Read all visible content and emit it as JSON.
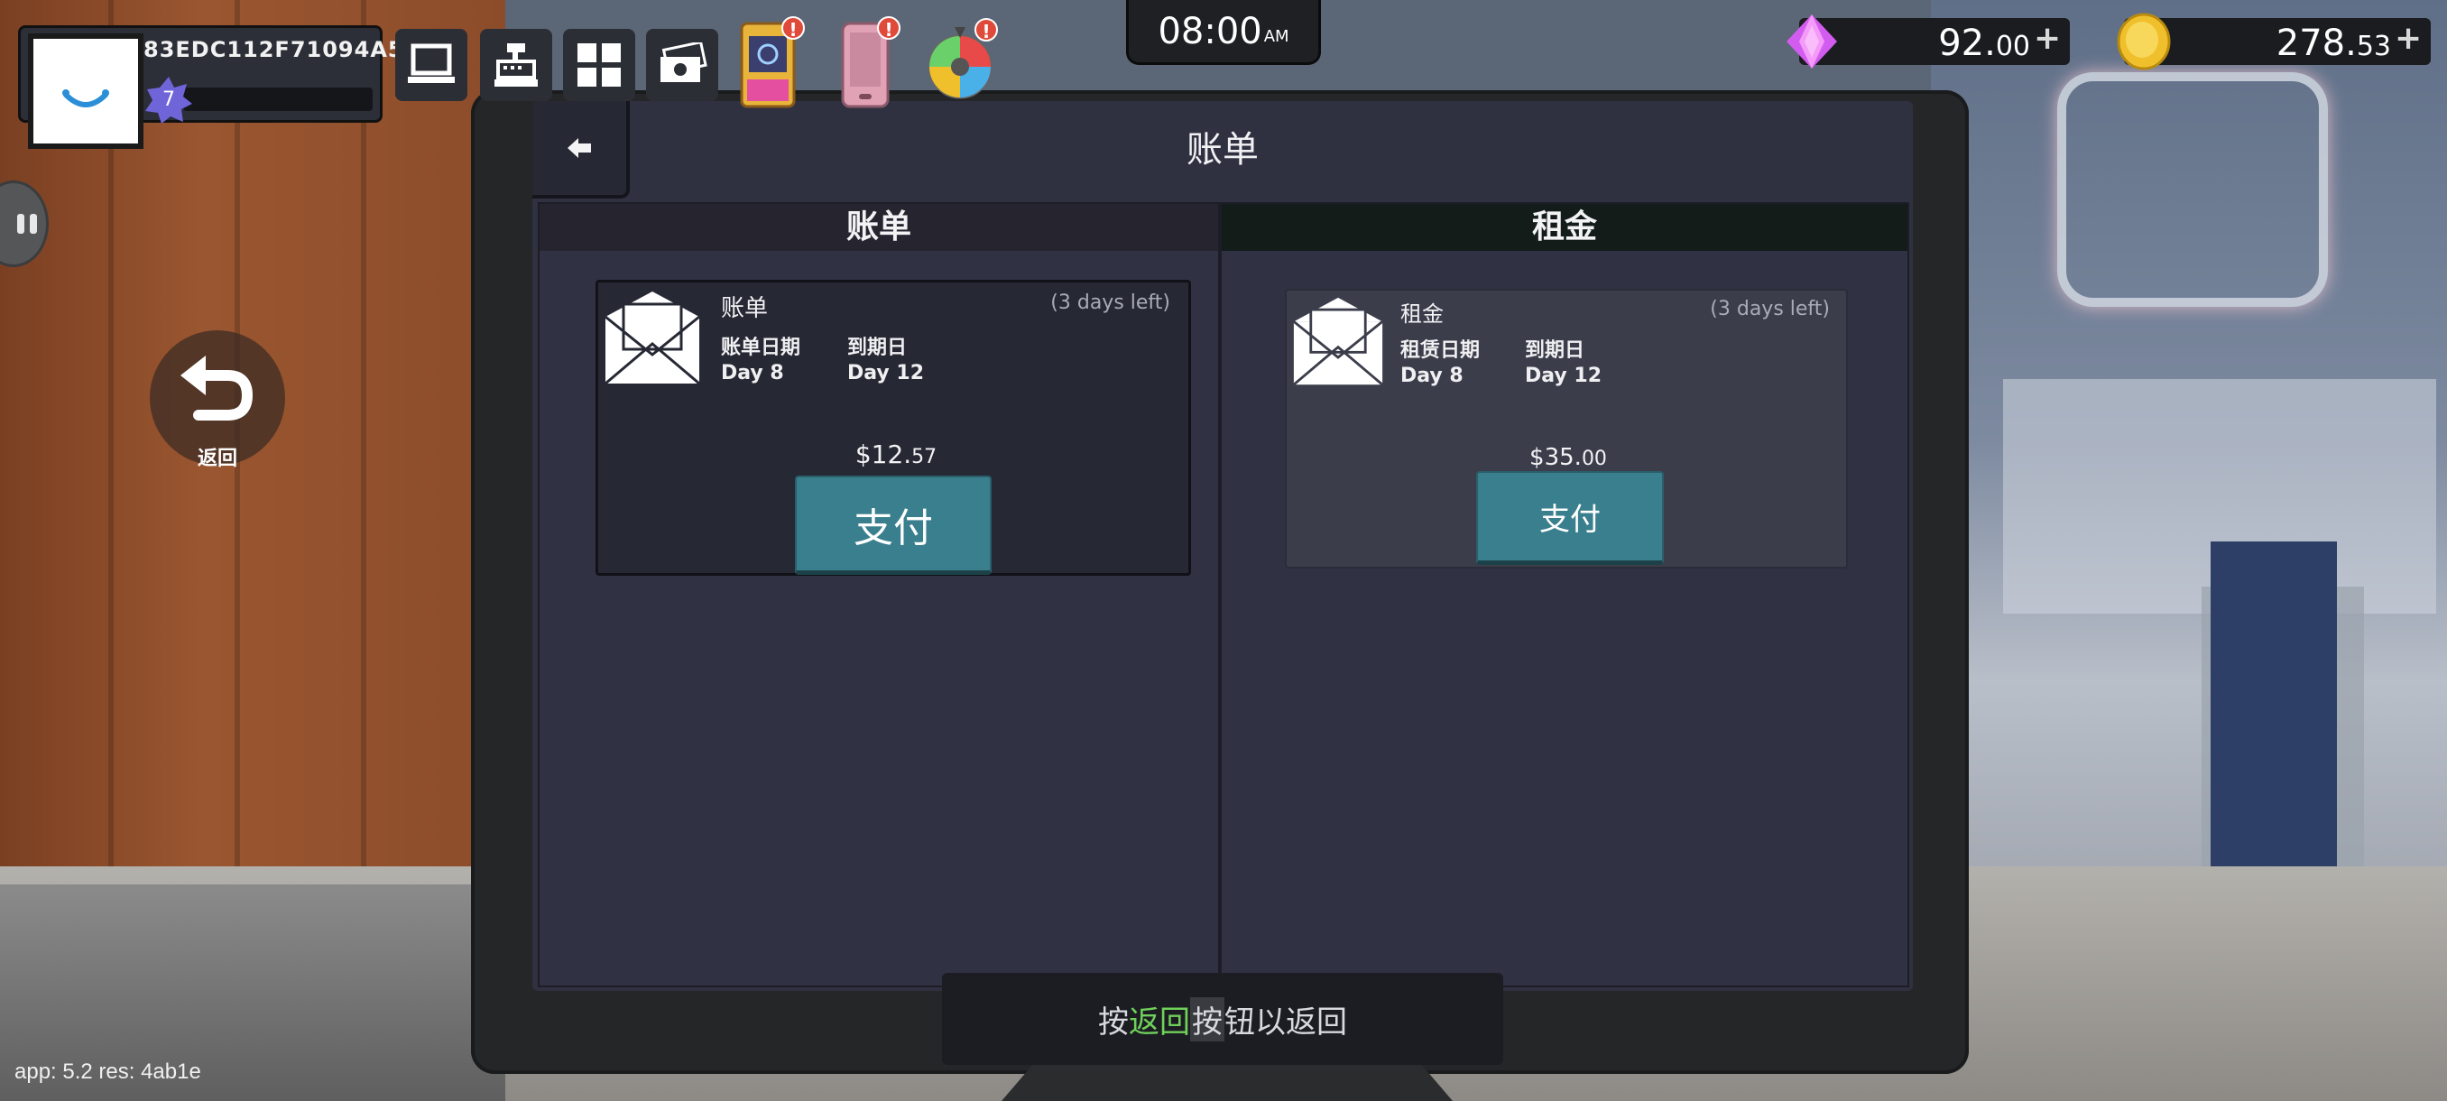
{
  "hud": {
    "player_id": "83EDC112F71094A5",
    "level": "7",
    "xp_progress": 0.0,
    "clock_time": "08:00",
    "clock_ampm": "AM",
    "gems_int": "92.",
    "gems_dec": "00",
    "coins_int": "278.",
    "coins_dec": "53",
    "alert_mark": "!",
    "currency_plus": "+",
    "side_back_label": "返回"
  },
  "bills_screen": {
    "title": "账单",
    "tabs": [
      {
        "label": "账单"
      },
      {
        "label": "租金"
      }
    ],
    "cards": [
      {
        "name": "账单",
        "days_left": "(3 days left)",
        "issue_label": "账单日期",
        "due_label": "到期日",
        "issue_value": "Day 8",
        "due_value": "Day 12",
        "amount_main": "$12.",
        "amount_cents": "57",
        "pay_label": "支付"
      },
      {
        "name": "租金",
        "days_left": "(3 days left)",
        "issue_label": "租赁日期",
        "due_label": "到期日",
        "issue_value": "Day 8",
        "due_value": "Day 12",
        "amount_main": "$35.",
        "amount_cents": "00",
        "pay_label": "支付"
      }
    ]
  },
  "hint": {
    "prefix": "按",
    "accent": "返回",
    "key": "按",
    "suffix": "钮以返回"
  },
  "version_text": "app: 5.2 res: 4ab1e",
  "colors": {
    "pay_button": "#3a7f8d",
    "hint_accent": "#6fd05a",
    "alert": "#e04a3a",
    "gem": "#d35cf0",
    "coin": "#f0c02c"
  }
}
